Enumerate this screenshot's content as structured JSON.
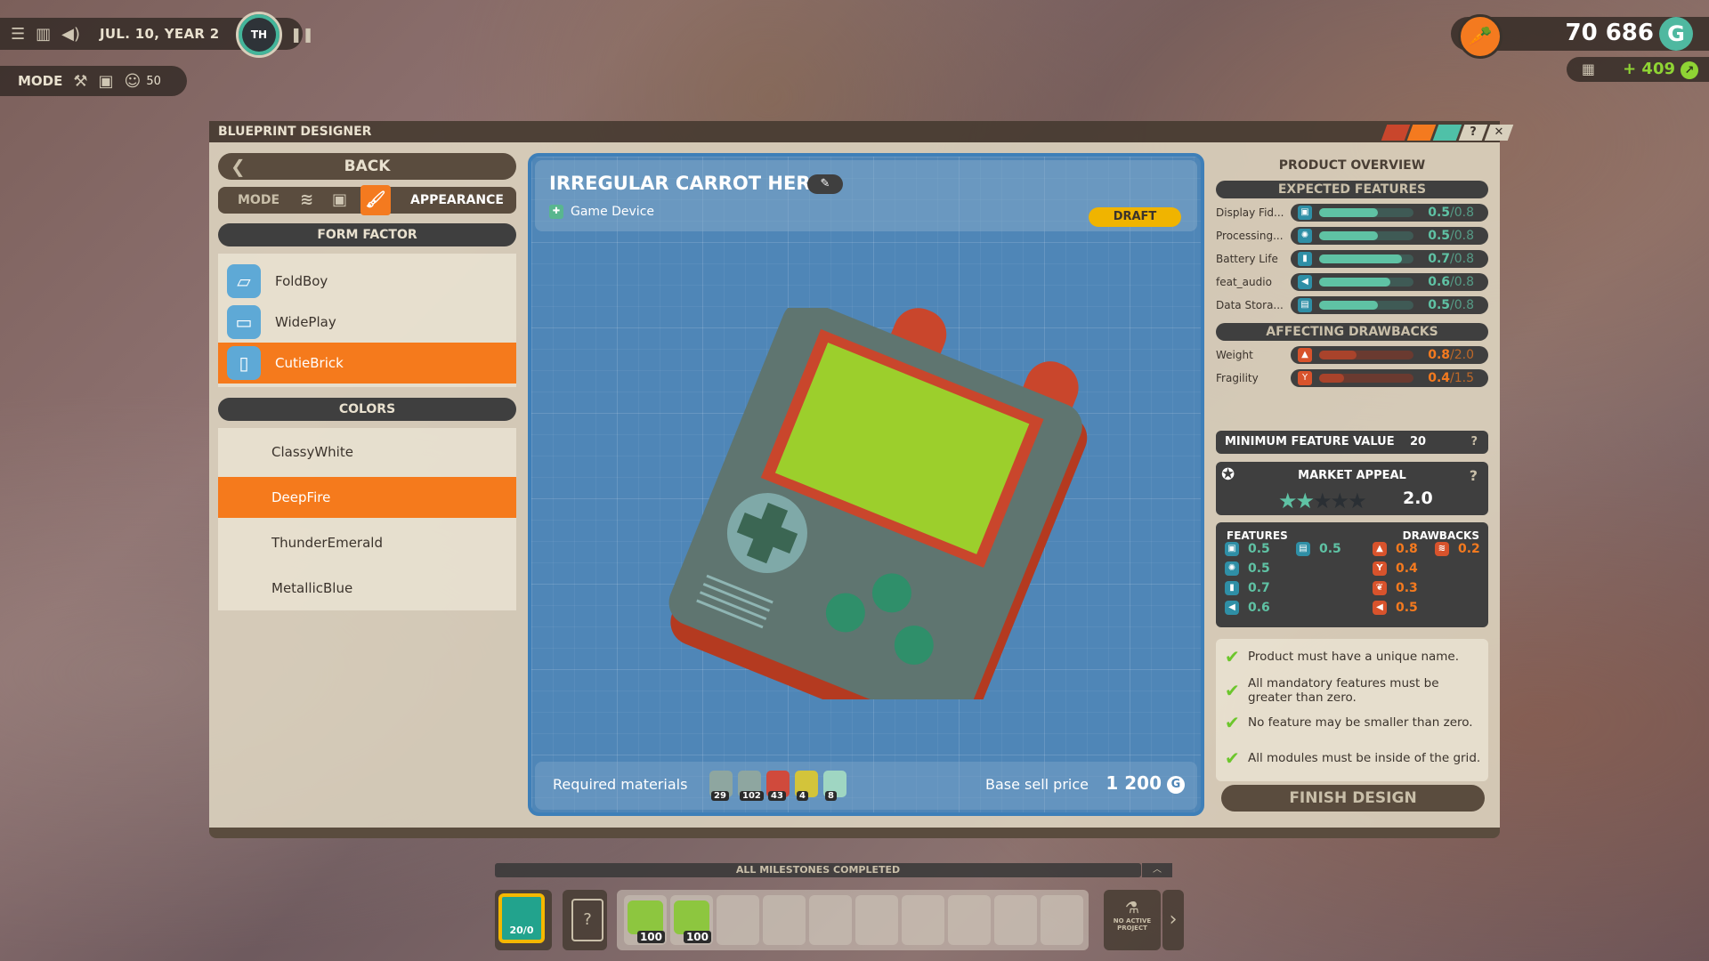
{
  "hud": {
    "menu_icon": "hamburger-menu-icon",
    "date": "JUL. 10, YEAR 2",
    "clock_label": "TH",
    "mode_label": "MODE",
    "worker_count": "50",
    "money": "70 686",
    "currency_symbol": "G",
    "income": "+ 409"
  },
  "window": {
    "title": "BLUEPRINT DESIGNER",
    "help_label": "?",
    "close_label": "✕",
    "tab_colors": [
      "#c9462c",
      "#f47a1f",
      "#4fc1a8"
    ]
  },
  "left": {
    "back_label": "BACK",
    "mode_label": "MODE",
    "mode_active": "APPEARANCE",
    "form_factor_header": "FORM FACTOR",
    "form_factors": [
      {
        "label": "FoldBoy",
        "selected": false
      },
      {
        "label": "WidePlay",
        "selected": false
      },
      {
        "label": "CutieBrick",
        "selected": true
      }
    ],
    "colors_header": "COLORS",
    "colors": [
      {
        "label": "ClassyWhite",
        "selected": false
      },
      {
        "label": "DeepFire",
        "selected": true
      },
      {
        "label": "ThunderEmerald",
        "selected": false
      },
      {
        "label": "MetallicBlue",
        "selected": false
      }
    ]
  },
  "blueprint": {
    "product_name": "IRREGULAR CARROT HERO",
    "category": "Game Device",
    "status": "DRAFT",
    "required_materials_label": "Required materials",
    "materials": [
      {
        "name": "plastic",
        "count": "29"
      },
      {
        "name": "chip",
        "count": "102"
      },
      {
        "name": "red-block",
        "count": "43"
      },
      {
        "name": "chemical",
        "count": "4"
      },
      {
        "name": "glass",
        "count": "8"
      }
    ],
    "base_price_label": "Base sell price",
    "base_price": "1 200",
    "currency_symbol": "G"
  },
  "overview": {
    "title": "PRODUCT OVERVIEW",
    "expected_header": "EXPECTED FEATURES",
    "expected": [
      {
        "name": "Display Fid...",
        "icon": "tv-icon",
        "glyph": "▣",
        "value": 0.5,
        "max": 0.8,
        "value_text": "0.5",
        "max_text": "/0.8"
      },
      {
        "name": "Processing...",
        "icon": "brain-icon",
        "glyph": "✺",
        "value": 0.5,
        "max": 0.8,
        "value_text": "0.5",
        "max_text": "/0.8"
      },
      {
        "name": "Battery Life",
        "icon": "battery-icon",
        "glyph": "▮",
        "value": 0.7,
        "max": 0.8,
        "value_text": "0.7",
        "max_text": "/0.8"
      },
      {
        "name": "feat_audio",
        "icon": "speaker-icon",
        "glyph": "◀",
        "value": 0.6,
        "max": 0.8,
        "value_text": "0.6",
        "max_text": "/0.8"
      },
      {
        "name": "Data Stora...",
        "icon": "floppy-icon",
        "glyph": "▤",
        "value": 0.5,
        "max": 0.8,
        "value_text": "0.5",
        "max_text": "/0.8"
      }
    ],
    "drawbacks_header": "AFFECTING DRAWBACKS",
    "drawbacks": [
      {
        "name": "Weight",
        "icon": "weight-icon",
        "glyph": "▲",
        "value": 0.8,
        "max": 2.0,
        "value_text": "0.8",
        "max_text": "/2.0"
      },
      {
        "name": "Fragility",
        "icon": "broken-glass-icon",
        "glyph": "Y",
        "value": 0.4,
        "max": 1.5,
        "value_text": "0.4",
        "max_text": "/1.5"
      }
    ],
    "min_feature_label": "MINIMUM FEATURE VALUE",
    "min_feature_value": "20",
    "help": "?",
    "market_appeal_label": "MARKET APPEAL",
    "market_appeal_stars": 2,
    "market_appeal_max": 5,
    "market_appeal_value": "2.0",
    "features_label": "FEATURES",
    "drawbacks_label": "DRAWBACKS",
    "feature_summary": [
      {
        "icon": "tv-icon",
        "glyph": "▣",
        "value": "0.5"
      },
      {
        "icon": "floppy-icon",
        "glyph": "▤",
        "value": "0.5"
      },
      {
        "icon": "brain-icon",
        "glyph": "✺",
        "value": "0.5"
      },
      {
        "icon": "battery-icon",
        "glyph": "▮",
        "value": "0.7"
      },
      {
        "icon": "speaker-icon",
        "glyph": "◀",
        "value": "0.6"
      }
    ],
    "drawback_summary": [
      {
        "icon": "weight-icon",
        "glyph": "▲",
        "value": "0.8"
      },
      {
        "icon": "heat-icon",
        "glyph": "≋",
        "value": "0.2"
      },
      {
        "icon": "broken-glass-icon",
        "glyph": "Y",
        "value": "0.4"
      },
      {
        "icon": "leaf-icon",
        "glyph": "❦",
        "value": "0.3"
      },
      {
        "icon": "noise-icon",
        "glyph": "◀",
        "value": "0.5"
      }
    ],
    "requirements": [
      "Product must have a unique name.",
      "All mandatory features must be greater than zero.",
      "No feature may be smaller than zero.",
      "All modules must be inside of the grid."
    ],
    "finish_label": "FINISH DESIGN"
  },
  "bottom": {
    "milestone_text": "ALL MILESTONES COMPLETED",
    "product_slot_label": "20/0",
    "inventory": [
      {
        "item": "circuit-board",
        "count": "100"
      },
      {
        "item": "circuit-board",
        "count": "100"
      }
    ],
    "empty_slots": 8,
    "no_project_label": "NO ACTIVE PROJECT"
  },
  "colors": {
    "accent_orange": "#f57a1c",
    "feature_teal": "#5fc2a4",
    "drawback_orange": "#f47a1f",
    "blueprint_blue": "#4f86b7",
    "draft_yellow": "#f0b400"
  }
}
